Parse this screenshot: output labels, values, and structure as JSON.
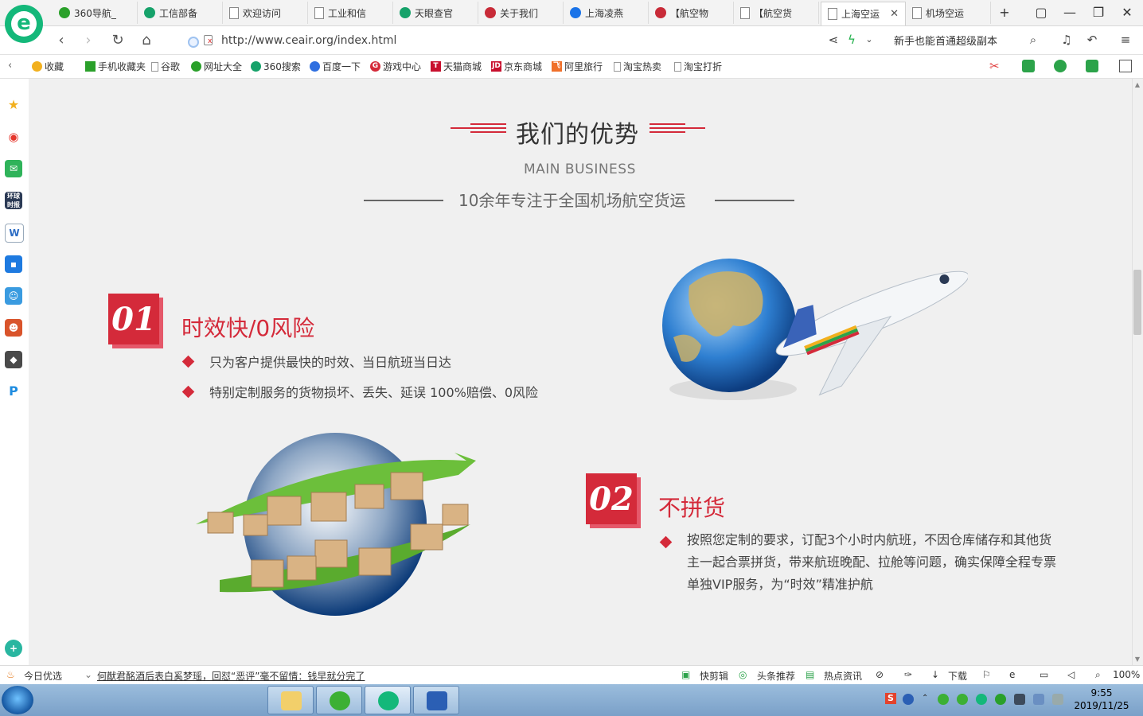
{
  "tabs": [
    {
      "label": "360导航_",
      "color": "#2aa02a",
      "active": false
    },
    {
      "label": "工信部备",
      "color": "#16a26a",
      "active": false
    },
    {
      "label": "欢迎访问",
      "color": "page",
      "active": false
    },
    {
      "label": "工业和信",
      "color": "page",
      "active": false
    },
    {
      "label": "天眼查官",
      "color": "#16a26a",
      "active": false
    },
    {
      "label": "关于我们",
      "color": "#c82b38",
      "active": false
    },
    {
      "label": "上海凌燕",
      "color": "#1a73e8",
      "active": false
    },
    {
      "label": "【航空物",
      "color": "#c82b38",
      "active": false
    },
    {
      "label": "【航空货",
      "color": "page",
      "active": false
    },
    {
      "label": "上海空运",
      "color": "page",
      "active": true
    },
    {
      "label": "机场空运",
      "color": "page",
      "active": false
    }
  ],
  "tab_close": "✕",
  "new_tab": "+",
  "window_controls": {
    "restore_glyph": "▢",
    "min": "—",
    "max": "❐",
    "close": "✕"
  },
  "address": {
    "url": "http://www.ceair.org/index.html",
    "ad_text": "新手也能首通超级副本"
  },
  "bookmarks": [
    {
      "label": "收藏",
      "icon": "star-icon"
    },
    {
      "label": "手机收藏夹",
      "icon": "phone-icon"
    },
    {
      "label": "谷歌",
      "icon": "page-icon"
    },
    {
      "label": "网址大全",
      "icon": "360-icon"
    },
    {
      "label": "360搜索",
      "icon": "360-search-icon"
    },
    {
      "label": "百度一下",
      "icon": "baidu-icon"
    },
    {
      "label": "游戏中心",
      "icon": "game-icon"
    },
    {
      "label": "天猫商城",
      "icon": "tmall-icon"
    },
    {
      "label": "京东商城",
      "icon": "jd-icon"
    },
    {
      "label": "阿里旅行",
      "icon": "ali-travel-icon"
    },
    {
      "label": "淘宝热卖",
      "icon": "page-icon"
    },
    {
      "label": "淘宝打折",
      "icon": "page-icon"
    }
  ],
  "page": {
    "title": "我们的优势",
    "subtitle_en": "MAIN BUSINESS",
    "tagline": "10余年专注于全国机场航空货运",
    "features": [
      {
        "num": "01",
        "title": "时效快/0风险",
        "points": [
          "只为客户提供最快的时效、当日航班当日达",
          "特别定制服务的货物损坏、丢失、延误 100%赔偿、0风险"
        ]
      },
      {
        "num": "02",
        "title": "不拼货",
        "lines": [
          "按照您定制的要求，订配3个小时内航班，不因仓库储存和其他货",
          "主一起合票拼货，带来航班晚配、拉舱等问题，确实保障全程专票",
          "单独VIP服务，为“时效”精准护航"
        ]
      }
    ]
  },
  "status": {
    "today": "今日优选",
    "news": "何猷君酩酒后表白奚梦瑶，回怼“恶评”毫不留情：钱早就分完了",
    "kuaijianji": "快剪辑",
    "toutiao": "头条推荐",
    "hot": "热点资讯",
    "download": "下载",
    "zoom": "100%"
  },
  "taskbar": {
    "time": "9:55",
    "date": "2019/11/25",
    "ime": "S"
  }
}
